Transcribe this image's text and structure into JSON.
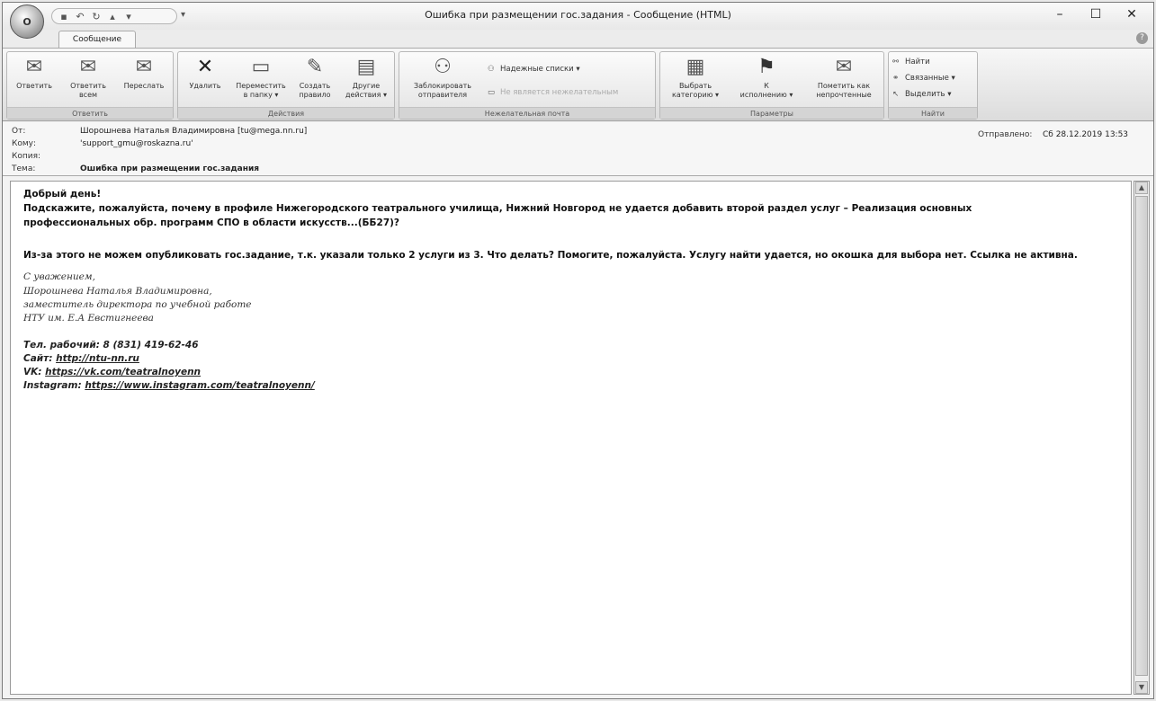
{
  "window": {
    "title": "Ошибка при размещении гос.задания - Сообщение (HTML)",
    "office_button": "O"
  },
  "ribbon": {
    "tab": "Сообщение",
    "groups": {
      "respond": {
        "label": "Ответить",
        "reply": "Ответить",
        "reply_all_1": "Ответить",
        "reply_all_2": "всем",
        "forward": "Переслать"
      },
      "actions": {
        "label": "Действия",
        "delete": "Удалить",
        "move_1": "Переместить",
        "move_2": "в папку ▾",
        "create_1": "Создать",
        "create_2": "правило",
        "other_1": "Другие",
        "other_2": "действия ▾"
      },
      "junk": {
        "label": "Нежелательная почта",
        "block_1": "Заблокировать",
        "block_2": "отправителя",
        "safe_lists": "Надежные списки ▾",
        "not_junk": "Не является нежелательным"
      },
      "options": {
        "label": "Параметры",
        "categorize_1": "Выбрать",
        "categorize_2": "категорию ▾",
        "followup_1": "К",
        "followup_2": "исполнению ▾",
        "unread_1": "Пометить как",
        "unread_2": "непрочтенные"
      },
      "find": {
        "label": "Найти",
        "find": "Найти",
        "related": "Связанные ▾",
        "select": "Выделить ▾"
      }
    }
  },
  "header": {
    "from_label": "От:",
    "from": "Шорошнева Наталья Владимировна [tu@mega.nn.ru]",
    "to_label": "Кому:",
    "to": "'support_gmu@roskazna.ru'",
    "cc_label": "Копия:",
    "cc": "",
    "subject_label": "Тема:",
    "subject": "Ошибка при размещении гос.задания",
    "sent_label": "Отправлено:",
    "sent": "Сб 28.12.2019 13:53"
  },
  "message": {
    "greeting": "Добрый день!",
    "line1": "Подскажите, пожалуйста, почему в профиле Нижегородского театрального училища, Нижний Новгород не удается добавить второй раздел услуг – Реализация основных",
    "line2": "профессиональных обр. программ СПО в области искусств...(ББ27)?",
    "line3": "Из-за этого не можем опубликовать гос.задание, т.к. указали только 2 услуги из 3. Что делать? Помогите, пожалуйста. Услугу найти удается, но окошка для выбора нет. Ссылка не активна.",
    "sig1": "С  уважением,",
    "sig2": "Шорошнева Наталья Владимировна,",
    "sig3": "заместитель директора по учебной работе",
    "sig4": "НТУ им.  Е.А  Евстигнеева",
    "phone": "Тел. рабочий: 8 (831) 419-62-46",
    "site_label": "Сайт: ",
    "site": "http://ntu-nn.ru",
    "vk_label": "VK: ",
    "vk": "https://vk.com/teatralnoyenn",
    "ig_label": "Instagram: ",
    "ig": "https://www.instagram.com/teatralnoyenn/"
  },
  "icons": {
    "minimize": "–",
    "maximize": "☐",
    "close": "✕"
  }
}
